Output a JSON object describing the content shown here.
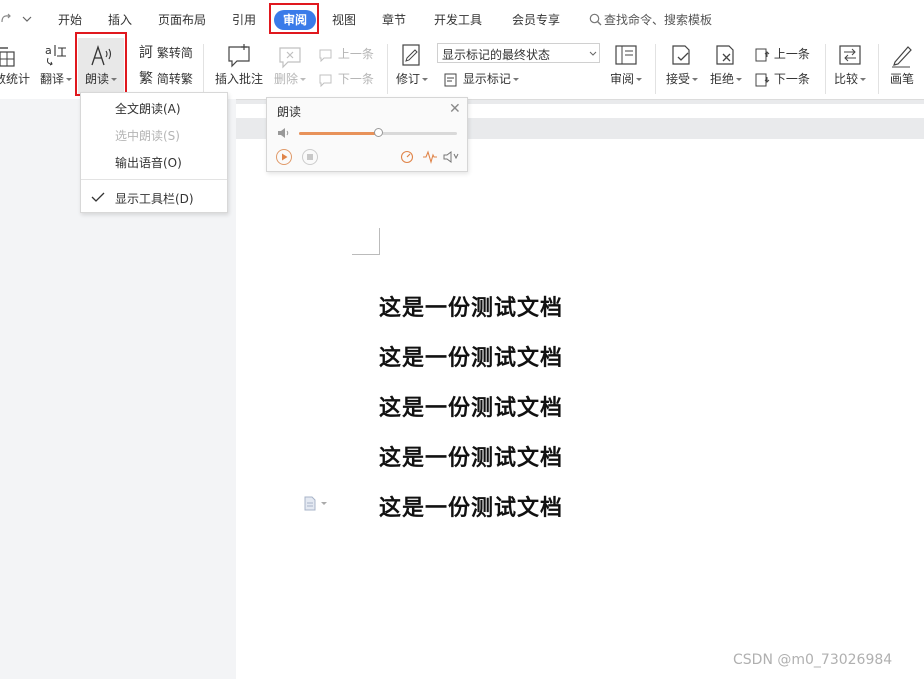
{
  "menubar": {
    "tabs": [
      {
        "label": "开始"
      },
      {
        "label": "插入"
      },
      {
        "label": "页面布局"
      },
      {
        "label": "引用"
      },
      {
        "label": "审阅"
      },
      {
        "label": "视图"
      },
      {
        "label": "章节"
      },
      {
        "label": "开发工具"
      },
      {
        "label": "会员专享"
      }
    ],
    "active_tab": "审阅",
    "search_label": "查找命令、搜索模板"
  },
  "ribbon": {
    "wordcount_label": "数统计",
    "translate_label": "翻译",
    "read_aloud_label": "朗读",
    "trad_label": "繁转简",
    "simp_label": "简转繁",
    "insert_comment_label": "插入批注",
    "delete_label": "删除",
    "prev_comment_label": "上一条",
    "next_comment_label": "下一条",
    "revise_label": "修订",
    "markup_select_value": "显示标记的最终状态",
    "show_markup_label": "显示标记",
    "review_pane_label": "审阅",
    "accept_label": "接受",
    "reject_label": "拒绝",
    "prev_change_label": "上一条",
    "next_change_label": "下一条",
    "compare_label": "比较",
    "ink_label": "画笔"
  },
  "dropdown": {
    "items": [
      {
        "label": "全文朗读(A)",
        "enabled": true
      },
      {
        "label": "选中朗读(S)",
        "enabled": false
      },
      {
        "label": "输出语音(O)",
        "enabled": true
      },
      {
        "label": "显示工具栏(D)",
        "enabled": true,
        "checked": true
      }
    ]
  },
  "read_panel": {
    "title": "朗读",
    "volume_fraction": 0.5
  },
  "document": {
    "lines": [
      "这是一份测试文档",
      "这是一份测试文档",
      "这是一份测试文档",
      "这是一份测试文档",
      "这是一份测试文档"
    ]
  },
  "watermark": "CSDN @m0_73026984",
  "colors": {
    "accent": "#3a7be9",
    "highlight_box": "#e0181e",
    "slider_fill": "#e8925a"
  }
}
